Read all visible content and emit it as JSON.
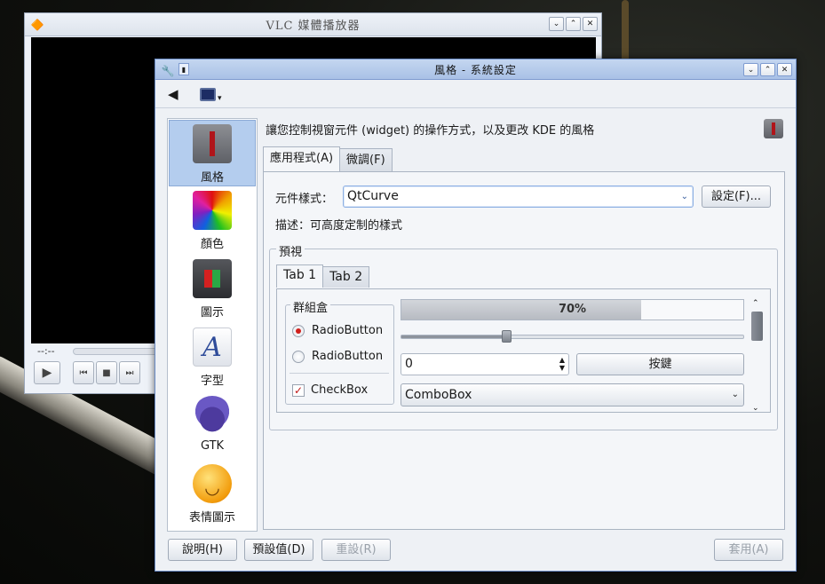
{
  "vlc": {
    "title": "VLC 媒體播放器",
    "time": "--:--",
    "play_icon": "play-icon",
    "prev_icon": "previous-icon",
    "stop_icon": "stop-icon",
    "next_icon": "next-icon"
  },
  "window": {
    "title": "風格 - 系統設定",
    "buttons": [
      "minimize",
      "maximize",
      "close"
    ]
  },
  "toolbar": {
    "back_icon": "back-arrow-icon",
    "view_icon": "monitor-icon"
  },
  "sidebar": {
    "items": [
      {
        "label": "風格",
        "icon": "style-icon",
        "active": true
      },
      {
        "label": "顏色",
        "icon": "colors-icon",
        "active": false
      },
      {
        "label": "圖示",
        "icon": "icons-icon",
        "active": false
      },
      {
        "label": "字型",
        "icon": "fonts-icon",
        "active": false
      },
      {
        "label": "GTK",
        "icon": "gtk-icon",
        "active": false
      },
      {
        "label": "表情圖示",
        "icon": "emoticons-icon",
        "active": false
      }
    ]
  },
  "main": {
    "description": "讓您控制視窗元件 (widget) 的操作方式，以及更改 KDE 的風格",
    "tabs": [
      {
        "label": "應用程式(A)",
        "mnemonic": "A",
        "active": true
      },
      {
        "label": "微調(F)",
        "mnemonic": "F",
        "active": false
      }
    ],
    "widget_style_label": "元件樣式：",
    "widget_style_value": "QtCurve",
    "configure_button": "設定(F)...",
    "style_description": "描述：可高度定制的樣式"
  },
  "preview": {
    "title": "預視",
    "tabs": [
      {
        "label": "Tab 1",
        "active": true
      },
      {
        "label": "Tab 2",
        "active": false
      }
    ],
    "groupbox_title": "群組盒",
    "radio1_label": "RadioButton",
    "radio2_label": "RadioButton",
    "checkbox_label": "CheckBox",
    "progress_text": "70%",
    "progress_value": 0.7,
    "slider_value": 0.31,
    "spin_value": "0",
    "push_button": "按鍵",
    "combo_value": "ComboBox"
  },
  "buttons": {
    "help": "說明(H)",
    "defaults": "預設值(D)",
    "reset": "重設(R)",
    "apply": "套用(A)"
  }
}
